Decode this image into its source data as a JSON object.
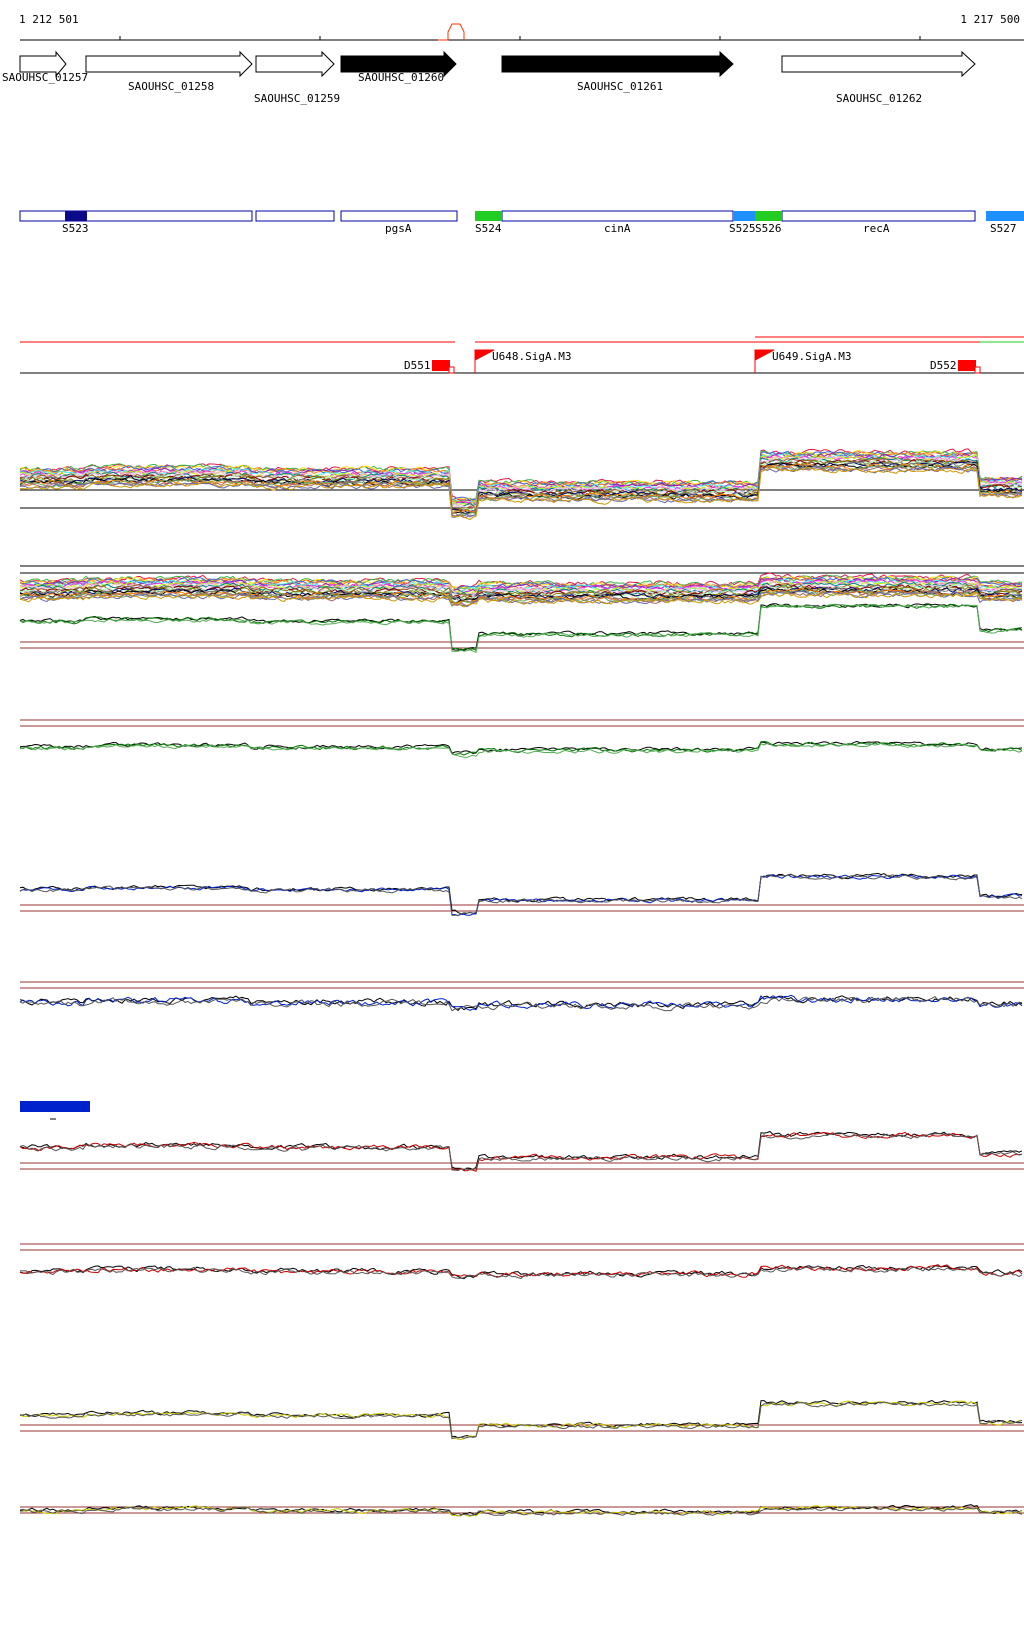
{
  "coords": {
    "start": "1 212 501",
    "end": "1 217 500"
  },
  "genes": [
    {
      "id": "SAOUHSC_01257",
      "strand": "+",
      "filled": false
    },
    {
      "id": "SAOUHSC_01258",
      "strand": "+",
      "filled": false
    },
    {
      "id": "SAOUHSC_01259",
      "strand": "+",
      "filled": false
    },
    {
      "id": "SAOUHSC_01260",
      "strand": "+",
      "filled": true
    },
    {
      "id": "SAOUHSC_01261",
      "strand": "+",
      "filled": true
    },
    {
      "id": "SAOUHSC_01262",
      "strand": "+",
      "filled": false
    }
  ],
  "segments": [
    {
      "label": "S523",
      "color": "#0a0a8a"
    },
    {
      "label": "pgsA",
      "color": "#ffffff"
    },
    {
      "label": "S524",
      "color": "#22cc22"
    },
    {
      "label": "cinA",
      "color": "#ffffff"
    },
    {
      "label": "S525",
      "color": "#1e90ff"
    },
    {
      "label": "S526",
      "color": "#22cc22"
    },
    {
      "label": "recA",
      "color": "#ffffff"
    },
    {
      "label": "S527",
      "color": "#1e90ff"
    }
  ],
  "features": [
    {
      "label": "D551",
      "type": "terminator"
    },
    {
      "label": "U648.SigA.M3",
      "type": "promoter"
    },
    {
      "label": "U649.SigA.M3",
      "type": "promoter"
    },
    {
      "label": "D552",
      "type": "terminator"
    }
  ],
  "colors": {
    "gene_outline": "#000000",
    "segment_outline": "#0000aa",
    "feature_red": "#ff0000",
    "green_track": "#007700",
    "blue_track": "#0022cc",
    "red_track": "#cc0000",
    "yellow_track": "#cccc00",
    "baseline": "#993333"
  }
}
